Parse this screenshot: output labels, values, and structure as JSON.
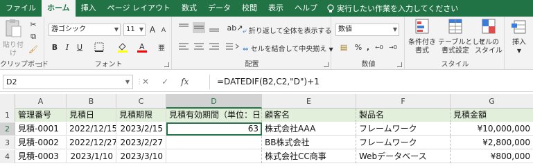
{
  "menu": {
    "tabs": [
      "ファイル",
      "ホーム",
      "挿入",
      "ページ レイアウト",
      "数式",
      "データ",
      "校閲",
      "表示",
      "ヘルプ"
    ],
    "active": "ホーム",
    "tell_me": "実行したい作業を入力してください"
  },
  "ribbon": {
    "clipboard": {
      "label": "クリップボード",
      "paste": "貼り付け"
    },
    "font": {
      "label": "フォント",
      "name": "游ゴシック",
      "size": "11",
      "bold": "B",
      "italic": "I",
      "underline": "U",
      "grow": "A",
      "shrink": "A"
    },
    "alignment": {
      "label": "配置",
      "wrap": "折り返して全体を表示する",
      "merge": "セルを結合して中央揃え"
    },
    "number": {
      "label": "数値",
      "format": "数値",
      "percent": "%",
      "comma": ","
    },
    "styles": {
      "label": "スタイル",
      "conditional": "条件付き\n書式",
      "table": "テーブルとして\n書式設定",
      "cell": "セルの\nスタイル"
    },
    "cells": {
      "insert": "挿入"
    }
  },
  "formula_bar": {
    "name_box": "D2",
    "formula": "=DATEDIF(B2,C2,\"D\")+1",
    "fx": "fx"
  },
  "grid": {
    "columns": [
      "A",
      "B",
      "C",
      "D",
      "E",
      "F",
      "G"
    ],
    "selected_column": "D",
    "selected_row": "2",
    "rows": [
      {
        "num": "1",
        "cells": [
          "管理番号",
          "見積日",
          "見積期限",
          "見積有効期間（単位：日）",
          "顧客名",
          "製品名",
          "見積金額"
        ]
      },
      {
        "num": "2",
        "cells": [
          "見積-0001",
          "2022/12/15",
          "2023/2/15",
          "63",
          "株式会社AAA",
          "フレームワーク",
          "¥10,000,000"
        ]
      },
      {
        "num": "3",
        "cells": [
          "見積-0002",
          "2022/12/27",
          "2023/2/27",
          "",
          "BB株式会社",
          "フレームワーク",
          "¥2,800,000"
        ]
      },
      {
        "num": "4",
        "cells": [
          "見積-0003",
          "2023/1/10",
          "2023/3/10",
          "",
          "株式会社CC商事",
          "Webデータベース",
          "¥800,000"
        ]
      }
    ]
  },
  "colors": {
    "accent": "#217346",
    "header_fill": "#e2efda"
  }
}
